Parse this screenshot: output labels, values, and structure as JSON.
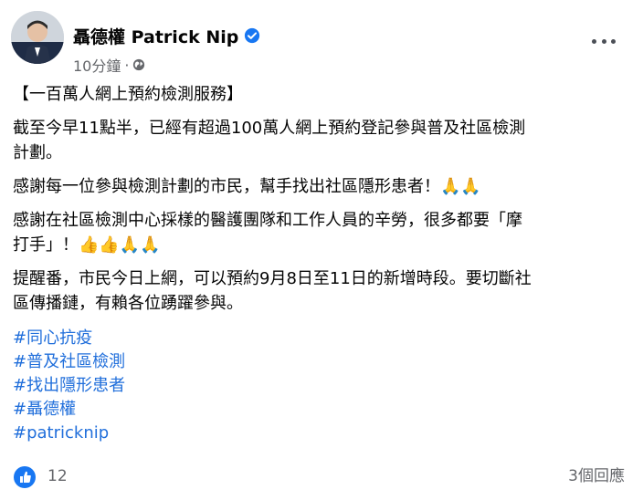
{
  "author": "聶德權 Patrick Nip",
  "time": "10分鐘",
  "post": {
    "title": "【一百萬人網上預約檢測服務】",
    "p1": "截至今早11點半，已經有超過100萬人網上預約登記參與普及社區檢測",
    "p1b": "計劃。",
    "p2": "感謝每一位參與檢測計劃的市民，幫手找出社區隱形患者！🙏🙏",
    "p3": "感謝在社區檢測中心採樣的醫護團隊和工作人員的辛勞，很多都要「摩",
    "p3b": "打手」！👍👍🙏🙏",
    "p4": "提醒番，市民今日上網，可以預約9月8日至11日的新增時段。要切斷社",
    "p4b": "區傳播鏈，有賴各位踴躍參與。"
  },
  "hashtags": [
    "#同心抗疫",
    "#普及社區檢測",
    "#找出隱形患者",
    "#聶德權",
    "#patricknip"
  ],
  "likes": "12",
  "comments": "3個回應",
  "icons": {
    "verified": "verified-badge-icon",
    "privacy": "globe-icon",
    "more": "more-options-icon",
    "like": "like-thumb-icon"
  },
  "colors": {
    "hashtag": "#216fdb",
    "verified": "#1877f2",
    "secondary_text": "#65676b"
  }
}
